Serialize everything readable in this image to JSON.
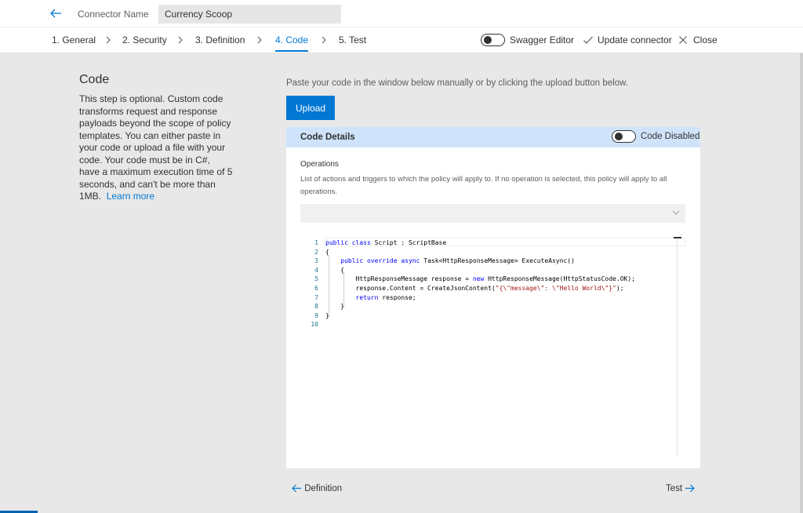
{
  "header": {
    "connector_label": "Connector Name",
    "connector_value": "Currency Scoop"
  },
  "steps": [
    {
      "label": "1. General"
    },
    {
      "label": "2. Security"
    },
    {
      "label": "3. Definition"
    },
    {
      "label": "4. Code",
      "active": true
    },
    {
      "label": "5. Test"
    }
  ],
  "toolbar": {
    "swagger_label": "Swagger Editor",
    "swagger_enabled": false,
    "update_label": "Update connector",
    "close_label": "Close"
  },
  "sidebar": {
    "title": "Code",
    "description": "This step is optional. Custom code transforms request and response payloads beyond the scope of policy templates. You can either paste in your code or upload a file with your code. Your code must be in C#, have a maximum execution time of 5 seconds, and can't be more than 1MB.",
    "learn_more": "Learn more"
  },
  "main": {
    "instructions": "Paste your code in the window below manually or by clicking the upload button below.",
    "upload_label": "Upload",
    "card_title": "Code Details",
    "code_toggle_label": "Code Disabled",
    "code_enabled": false,
    "operations_label": "Operations",
    "operations_help": "List of actions and triggers to which the policy will apply to. If no operation is selected, this policy will apply to all operations.",
    "operations_selected": ""
  },
  "editor": {
    "lines": [
      "public class Script : ScriptBase",
      "{",
      "    public override async Task<HttpResponseMessage> ExecuteAsync()",
      "    {",
      "        HttpResponseMessage response = new HttpResponseMessage(HttpStatusCode.OK);",
      "        response.Content = CreateJsonContent(\"{\\\"message\\\": \\\"Hello World\\\"}\");",
      "        return response;",
      "    }",
      "}",
      ""
    ]
  },
  "footer": {
    "prev_label": "Definition",
    "next_label": "Test"
  },
  "colors": {
    "accent": "#0078d4",
    "card_header": "#cfe4fa",
    "page_bg": "#e8e8e8"
  }
}
